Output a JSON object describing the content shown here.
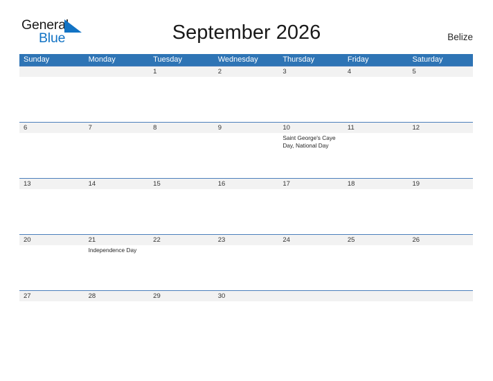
{
  "brand": {
    "name_part1": "General",
    "name_part2": "Blue",
    "flag_icon": "flag-triangle-icon",
    "accent_color": "#1273c4"
  },
  "header": {
    "title": "September 2026",
    "region": "Belize"
  },
  "theme": {
    "header_blue": "#2e74b5",
    "row_band_gray": "#f2f2f2",
    "row_border_blue": "#4a7ebb",
    "text_color": "#262626"
  },
  "calendar": {
    "month": "September",
    "year": "2026",
    "day_headers": [
      "Sunday",
      "Monday",
      "Tuesday",
      "Wednesday",
      "Thursday",
      "Friday",
      "Saturday"
    ],
    "weeks": [
      [
        {
          "date": "",
          "event": ""
        },
        {
          "date": "",
          "event": ""
        },
        {
          "date": "1",
          "event": ""
        },
        {
          "date": "2",
          "event": ""
        },
        {
          "date": "3",
          "event": ""
        },
        {
          "date": "4",
          "event": ""
        },
        {
          "date": "5",
          "event": ""
        }
      ],
      [
        {
          "date": "6",
          "event": ""
        },
        {
          "date": "7",
          "event": ""
        },
        {
          "date": "8",
          "event": ""
        },
        {
          "date": "9",
          "event": ""
        },
        {
          "date": "10",
          "event": "Saint George's Caye Day, National Day"
        },
        {
          "date": "11",
          "event": ""
        },
        {
          "date": "12",
          "event": ""
        }
      ],
      [
        {
          "date": "13",
          "event": ""
        },
        {
          "date": "14",
          "event": ""
        },
        {
          "date": "15",
          "event": ""
        },
        {
          "date": "16",
          "event": ""
        },
        {
          "date": "17",
          "event": ""
        },
        {
          "date": "18",
          "event": ""
        },
        {
          "date": "19",
          "event": ""
        }
      ],
      [
        {
          "date": "20",
          "event": ""
        },
        {
          "date": "21",
          "event": "Independence Day"
        },
        {
          "date": "22",
          "event": ""
        },
        {
          "date": "23",
          "event": ""
        },
        {
          "date": "24",
          "event": ""
        },
        {
          "date": "25",
          "event": ""
        },
        {
          "date": "26",
          "event": ""
        }
      ],
      [
        {
          "date": "27",
          "event": ""
        },
        {
          "date": "28",
          "event": ""
        },
        {
          "date": "29",
          "event": ""
        },
        {
          "date": "30",
          "event": ""
        },
        {
          "date": "",
          "event": ""
        },
        {
          "date": "",
          "event": ""
        },
        {
          "date": "",
          "event": ""
        }
      ]
    ]
  }
}
